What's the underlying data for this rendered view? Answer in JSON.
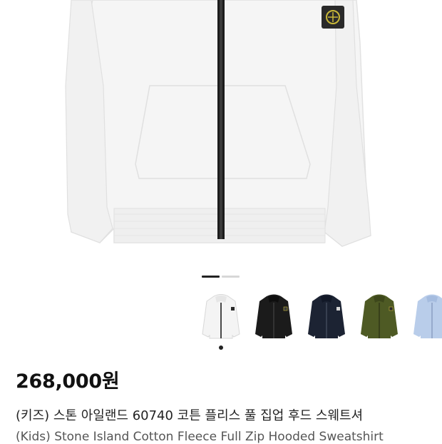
{
  "product": {
    "price": "268,000원",
    "title_ko": "(키즈) 스톤 아일랜드 60740 코튼 플리스 풀 집업 후드 스웨트셔",
    "title_en": "(Kids) Stone Island Cotton Fleece Full Zip Hooded Sweatshirt"
  },
  "gallery": {
    "slides_total": 2,
    "slide_active": 1
  },
  "color_options": [
    {
      "name": "white",
      "color": "#f4f4f4"
    },
    {
      "name": "black",
      "color": "#1b1b1b"
    },
    {
      "name": "navy",
      "color": "#1c2333"
    },
    {
      "name": "olive",
      "color": "#4e5a24"
    },
    {
      "name": "light-blue",
      "color": "#b9cdea"
    }
  ],
  "colors": {
    "zipper": "#1c1c1c",
    "badge": "#2a2a2a",
    "badge_accent": "#c9b838"
  }
}
